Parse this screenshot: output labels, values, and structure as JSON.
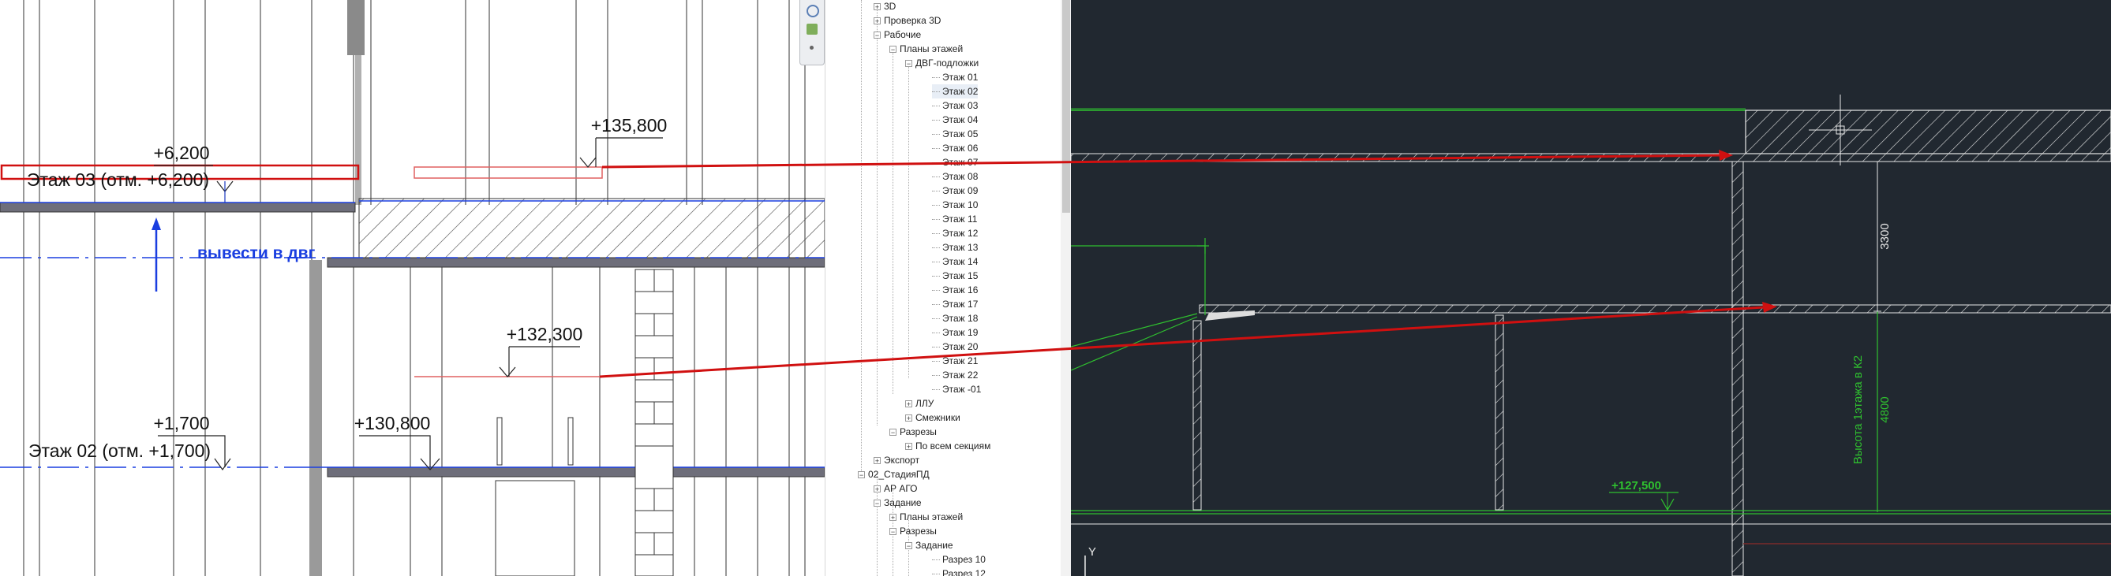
{
  "left_view": {
    "labels": {
      "elev_6200": "+6,200",
      "floor3_label": "Этаж 03 (отм. +6,200)",
      "elev_135800": "+135,800",
      "export_note": "вывести в двг",
      "elev_132300": "+132,300",
      "elev_1700": "+1,700",
      "floor2_label": "Этаж 02 (отм. +1,700)",
      "elev_130800": "+130,800"
    }
  },
  "tree": {
    "items": [
      {
        "label": "3D",
        "toggle": "+"
      },
      {
        "label": "Проверка 3D",
        "toggle": "+"
      },
      {
        "label": "Рабочие",
        "toggle": "−"
      },
      {
        "label": "Планы этажей",
        "toggle": "−"
      },
      {
        "label": "ДВГ-подложки",
        "toggle": "−"
      },
      {
        "label": "Этаж 01",
        "toggle": ""
      },
      {
        "label": "Этаж 02",
        "toggle": ""
      },
      {
        "label": "Этаж 03",
        "toggle": ""
      },
      {
        "label": "Этаж 04",
        "toggle": ""
      },
      {
        "label": "Этаж 05",
        "toggle": ""
      },
      {
        "label": "Этаж 06",
        "toggle": ""
      },
      {
        "label": "Этаж 07",
        "toggle": ""
      },
      {
        "label": "Этаж 08",
        "toggle": ""
      },
      {
        "label": "Этаж 09",
        "toggle": ""
      },
      {
        "label": "Этаж 10",
        "toggle": ""
      },
      {
        "label": "Этаж 11",
        "toggle": ""
      },
      {
        "label": "Этаж 12",
        "toggle": ""
      },
      {
        "label": "Этаж 13",
        "toggle": ""
      },
      {
        "label": "Этаж 14",
        "toggle": ""
      },
      {
        "label": "Этаж 15",
        "toggle": ""
      },
      {
        "label": "Этаж 16",
        "toggle": ""
      },
      {
        "label": "Этаж 17",
        "toggle": ""
      },
      {
        "label": "Этаж 18",
        "toggle": ""
      },
      {
        "label": "Этаж 19",
        "toggle": ""
      },
      {
        "label": "Этаж 20",
        "toggle": ""
      },
      {
        "label": "Этаж 21",
        "toggle": ""
      },
      {
        "label": "Этаж 22",
        "toggle": ""
      },
      {
        "label": "Этаж -01",
        "toggle": ""
      },
      {
        "label": "ЛЛУ",
        "toggle": "+"
      },
      {
        "label": "Смежники",
        "toggle": "+"
      },
      {
        "label": "Разрезы",
        "toggle": "−"
      },
      {
        "label": "По всем секциям",
        "toggle": "+"
      },
      {
        "label": "Экспорт",
        "toggle": "+"
      },
      {
        "label": "02_СтадияПД",
        "toggle": "−"
      },
      {
        "label": "АР АГО",
        "toggle": "+"
      },
      {
        "label": "Задание",
        "toggle": "−"
      },
      {
        "label": "Планы этажей",
        "toggle": "+"
      },
      {
        "label": "Разрезы",
        "toggle": "−"
      },
      {
        "label": "Задание",
        "toggle": "−"
      },
      {
        "label": "Разрез 10",
        "toggle": ""
      },
      {
        "label": "Разрез 12",
        "toggle": ""
      }
    ]
  },
  "cad_view": {
    "labels": {
      "dim_3300": "3300",
      "dim_4800": "4800",
      "height_note": "Высота 1этажа в К2",
      "elev_127500": "+127,500",
      "axis_y": "Y"
    }
  },
  "colors": {
    "cad_background": "#212830",
    "annotation_red": "#d01010",
    "revit_blue": "#1a3ee0",
    "cad_green": "#2fc02f"
  }
}
